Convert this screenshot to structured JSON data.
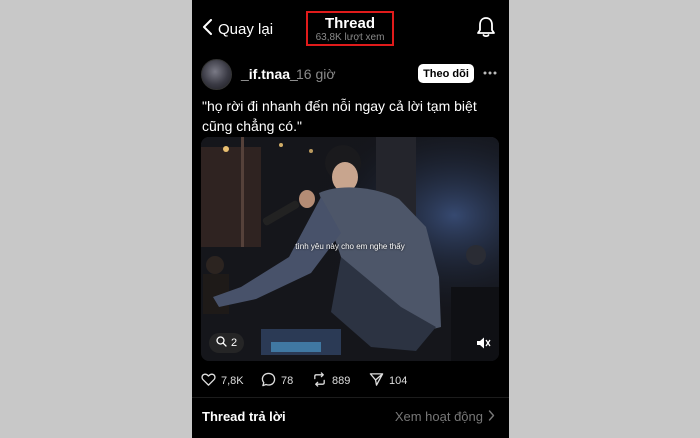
{
  "header": {
    "back_label": "Quay lại",
    "title": "Thread",
    "views": "63,8K lượt xem"
  },
  "post": {
    "username": "_if.tnaa_",
    "time": "16 giờ",
    "follow_label": "Theo dõi",
    "text": "\"họ rời đi nhanh đến nỗi ngay cả lời tạm biệt cũng chẳng có.\"",
    "video_caption": "tình yêu này cho em nghe thấy",
    "reply_count_pill": "2"
  },
  "actions": {
    "likes": "7,8K",
    "comments": "78",
    "reposts": "889",
    "shares": "104"
  },
  "footer": {
    "replies_title": "Thread trả lời",
    "activity_link": "Xem hoạt động"
  },
  "icons": {
    "back": "chevron-left-icon",
    "bell": "bell-icon",
    "more": "more-horizontal-icon",
    "like": "heart-icon",
    "comment": "comment-icon",
    "repost": "repost-icon",
    "share": "send-icon",
    "mute": "mute-icon"
  },
  "colors": {
    "background": "#000000",
    "highlight_box": "#e01b1b",
    "muted_text": "#8a8a8a"
  }
}
